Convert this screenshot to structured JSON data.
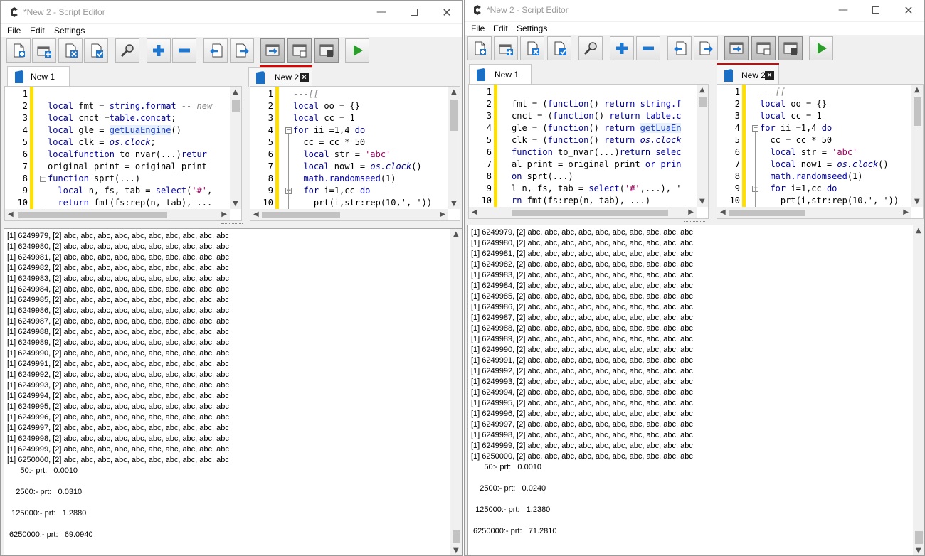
{
  "windows": [
    {
      "id": "winA",
      "title": "*New 2 - Script Editor",
      "menu": [
        "File",
        "Edit",
        "Settings"
      ],
      "tabs": [
        {
          "label": "New 1"
        },
        {
          "label": "New 2"
        }
      ],
      "editor1": {
        "line_numbers": [
          "1",
          "2",
          "3",
          "4",
          "5",
          "6",
          "7",
          "8",
          "9",
          "10"
        ],
        "lines": [
          [],
          [
            [
              "kw",
              "local"
            ],
            [
              "",
              "fmt = "
            ],
            [
              "blt",
              "string.format"
            ],
            [
              "cm",
              " -- new"
            ]
          ],
          [
            [
              "kw",
              "local"
            ],
            [
              "",
              "cnct ="
            ],
            [
              "blt",
              "table.concat"
            ],
            [
              "",
              ";"
            ]
          ],
          [
            [
              "kw",
              "local"
            ],
            [
              "",
              "gle = "
            ],
            [
              "hl",
              "getLuaEngine"
            ],
            [
              "",
              "()"
            ]
          ],
          [
            [
              "kw",
              "local"
            ],
            [
              "",
              "clk = "
            ],
            [
              "it",
              "os.clock"
            ],
            [
              "",
              ";"
            ]
          ],
          [
            [
              "kw",
              "local"
            ],
            [
              "",
              ""
            ],
            [
              "kw",
              "function"
            ],
            [
              "",
              " to_nvar(...)"
            ],
            [
              "kw",
              "retur"
            ]
          ],
          [
            [
              "",
              "original_print = original_print"
            ]
          ],
          [
            [
              "kw",
              "function"
            ],
            [
              "",
              " sprt(...)"
            ]
          ],
          [
            [
              "",
              "  "
            ],
            [
              "kw",
              "local"
            ],
            [
              "",
              " n, fs, tab = "
            ],
            [
              "blt",
              "select"
            ],
            [
              "",
              "("
            ],
            [
              "str",
              "'#'"
            ],
            [
              "",
              ","
            ]
          ],
          [
            [
              "",
              "  "
            ],
            [
              "kw",
              "return"
            ],
            [
              "",
              " fmt(fs:rep(n, tab), ..."
            ]
          ]
        ]
      },
      "editor2": {
        "line_numbers": [
          "1",
          "2",
          "3",
          "4",
          "5",
          "6",
          "7",
          "8",
          "9",
          "10"
        ],
        "lines": [
          [
            [
              "cm",
              "---[["
            ]
          ],
          [
            [
              "kw",
              "local"
            ],
            [
              "",
              " oo = {}"
            ]
          ],
          [
            [
              "kw",
              "local"
            ],
            [
              "",
              " cc = 1"
            ]
          ],
          [
            [
              "kw",
              "for"
            ],
            [
              "",
              " ii =1,4 "
            ],
            [
              "kw",
              "do"
            ]
          ],
          [
            [
              "",
              "  cc = cc * 50"
            ]
          ],
          [
            [
              "",
              "  "
            ],
            [
              "kw",
              "local"
            ],
            [
              "",
              " str = "
            ],
            [
              "str",
              "'abc'"
            ]
          ],
          [
            [
              "",
              "  "
            ],
            [
              "kw",
              "local"
            ],
            [
              "",
              " now1 = "
            ],
            [
              "it",
              "os.clock"
            ],
            [
              "",
              "()"
            ]
          ],
          [
            [
              "",
              "  "
            ],
            [
              "blt",
              "math.randomseed"
            ],
            [
              "",
              "(1)"
            ]
          ],
          [
            [
              "",
              "  "
            ],
            [
              "kw",
              "for"
            ],
            [
              "",
              " i=1,cc "
            ],
            [
              "kw",
              "do"
            ]
          ],
          [
            [
              "",
              "    prt(i,str:rep(10,', '))"
            ]
          ]
        ]
      },
      "output": {
        "lines": [
          "[1] 6249979, [2] abc, abc, abc, abc, abc, abc, abc, abc, abc, abc",
          "[1] 6249980, [2] abc, abc, abc, abc, abc, abc, abc, abc, abc, abc",
          "[1] 6249981, [2] abc, abc, abc, abc, abc, abc, abc, abc, abc, abc",
          "[1] 6249982, [2] abc, abc, abc, abc, abc, abc, abc, abc, abc, abc",
          "[1] 6249983, [2] abc, abc, abc, abc, abc, abc, abc, abc, abc, abc",
          "[1] 6249984, [2] abc, abc, abc, abc, abc, abc, abc, abc, abc, abc",
          "[1] 6249985, [2] abc, abc, abc, abc, abc, abc, abc, abc, abc, abc",
          "[1] 6249986, [2] abc, abc, abc, abc, abc, abc, abc, abc, abc, abc",
          "[1] 6249987, [2] abc, abc, abc, abc, abc, abc, abc, abc, abc, abc",
          "[1] 6249988, [2] abc, abc, abc, abc, abc, abc, abc, abc, abc, abc",
          "[1] 6249989, [2] abc, abc, abc, abc, abc, abc, abc, abc, abc, abc",
          "[1] 6249990, [2] abc, abc, abc, abc, abc, abc, abc, abc, abc, abc",
          "[1] 6249991, [2] abc, abc, abc, abc, abc, abc, abc, abc, abc, abc",
          "[1] 6249992, [2] abc, abc, abc, abc, abc, abc, abc, abc, abc, abc",
          "[1] 6249993, [2] abc, abc, abc, abc, abc, abc, abc, abc, abc, abc",
          "[1] 6249994, [2] abc, abc, abc, abc, abc, abc, abc, abc, abc, abc",
          "[1] 6249995, [2] abc, abc, abc, abc, abc, abc, abc, abc, abc, abc",
          "[1] 6249996, [2] abc, abc, abc, abc, abc, abc, abc, abc, abc, abc",
          "[1] 6249997, [2] abc, abc, abc, abc, abc, abc, abc, abc, abc, abc",
          "[1] 6249998, [2] abc, abc, abc, abc, abc, abc, abc, abc, abc, abc",
          "[1] 6249999, [2] abc, abc, abc, abc, abc, abc, abc, abc, abc, abc",
          "[1] 6250000, [2] abc, abc, abc, abc, abc, abc, abc, abc, abc, abc",
          "      50:- prt:   0.0010",
          "",
          "    2500:- prt:   0.0310",
          "",
          "  125000:- prt:   1.2880",
          "",
          " 6250000:- prt:   69.0940"
        ]
      }
    },
    {
      "id": "winB",
      "title": "*New 2 - Script Editor",
      "menu": [
        "File",
        "Edit",
        "Settings"
      ],
      "tabs": [
        {
          "label": "New 1"
        },
        {
          "label": "New 2"
        }
      ],
      "editor1": {
        "line_numbers": [
          "1",
          "2",
          "3",
          "4",
          "5",
          "6",
          "7",
          "8",
          "9",
          "10"
        ],
        "lines": [
          [],
          [
            [
              "",
              "fmt = ("
            ],
            [
              "kw",
              "function"
            ],
            [
              "",
              "() "
            ],
            [
              "kw",
              "return"
            ],
            [
              "",
              " "
            ],
            [
              "blt",
              "string.f"
            ]
          ],
          [
            [
              "",
              "cnct = ("
            ],
            [
              "kw",
              "function"
            ],
            [
              "",
              "() "
            ],
            [
              "kw",
              "return"
            ],
            [
              "",
              " "
            ],
            [
              "blt",
              "table.c"
            ]
          ],
          [
            [
              "",
              "gle = ("
            ],
            [
              "kw",
              "function"
            ],
            [
              "",
              "() "
            ],
            [
              "kw",
              "return"
            ],
            [
              "",
              " "
            ],
            [
              "hl",
              "getLuaEn"
            ]
          ],
          [
            [
              "",
              "clk = ("
            ],
            [
              "kw",
              "function"
            ],
            [
              "",
              "() "
            ],
            [
              "kw",
              "return"
            ],
            [
              "",
              " "
            ],
            [
              "it",
              "os.clock"
            ]
          ],
          [
            [
              "kw",
              "function"
            ],
            [
              "",
              " to_nvar(...)"
            ],
            [
              "kw",
              "return"
            ],
            [
              "",
              " "
            ],
            [
              "blt",
              "selec"
            ]
          ],
          [
            [
              "",
              "al_print = original_print "
            ],
            [
              "kw",
              "or"
            ],
            [
              "",
              " "
            ],
            [
              "blt",
              "prin"
            ]
          ],
          [
            [
              "kw",
              "on"
            ],
            [
              "",
              " sprt(...)"
            ]
          ],
          [
            [
              "",
              "l n, fs, tab = "
            ],
            [
              "blt",
              "select"
            ],
            [
              "",
              "("
            ],
            [
              "str",
              "'#'"
            ],
            [
              "",
              ",...), '"
            ]
          ],
          [
            [
              "kw",
              "rn"
            ],
            [
              "",
              " fmt(fs:rep(n, tab), ...)"
            ]
          ]
        ]
      },
      "editor2": {
        "line_numbers": [
          "1",
          "2",
          "3",
          "4",
          "5",
          "6",
          "7",
          "8",
          "9",
          "10"
        ],
        "lines": [
          [
            [
              "cm",
              "---[["
            ]
          ],
          [
            [
              "kw",
              "local"
            ],
            [
              "",
              " oo = {}"
            ]
          ],
          [
            [
              "kw",
              "local"
            ],
            [
              "",
              " cc = 1"
            ]
          ],
          [
            [
              "kw",
              "for"
            ],
            [
              "",
              " ii =1,4 "
            ],
            [
              "kw",
              "do"
            ]
          ],
          [
            [
              "",
              "  cc = cc * 50"
            ]
          ],
          [
            [
              "",
              "  "
            ],
            [
              "kw",
              "local"
            ],
            [
              "",
              " str = "
            ],
            [
              "str",
              "'abc'"
            ]
          ],
          [
            [
              "",
              "  "
            ],
            [
              "kw",
              "local"
            ],
            [
              "",
              " now1 = "
            ],
            [
              "it",
              "os.clock"
            ],
            [
              "",
              "()"
            ]
          ],
          [
            [
              "",
              "  "
            ],
            [
              "blt",
              "math.randomseed"
            ],
            [
              "",
              "(1)"
            ]
          ],
          [
            [
              "",
              "  "
            ],
            [
              "kw",
              "for"
            ],
            [
              "",
              " i=1,cc "
            ],
            [
              "kw",
              "do"
            ]
          ],
          [
            [
              "",
              "    prt(i,str:rep(10,', '))"
            ]
          ]
        ]
      },
      "output": {
        "lines": [
          "[1] 6249979, [2] abc, abc, abc, abc, abc, abc, abc, abc, abc, abc",
          "[1] 6249980, [2] abc, abc, abc, abc, abc, abc, abc, abc, abc, abc",
          "[1] 6249981, [2] abc, abc, abc, abc, abc, abc, abc, abc, abc, abc",
          "[1] 6249982, [2] abc, abc, abc, abc, abc, abc, abc, abc, abc, abc",
          "[1] 6249983, [2] abc, abc, abc, abc, abc, abc, abc, abc, abc, abc",
          "[1] 6249984, [2] abc, abc, abc, abc, abc, abc, abc, abc, abc, abc",
          "[1] 6249985, [2] abc, abc, abc, abc, abc, abc, abc, abc, abc, abc",
          "[1] 6249986, [2] abc, abc, abc, abc, abc, abc, abc, abc, abc, abc",
          "[1] 6249987, [2] abc, abc, abc, abc, abc, abc, abc, abc, abc, abc",
          "[1] 6249988, [2] abc, abc, abc, abc, abc, abc, abc, abc, abc, abc",
          "[1] 6249989, [2] abc, abc, abc, abc, abc, abc, abc, abc, abc, abc",
          "[1] 6249990, [2] abc, abc, abc, abc, abc, abc, abc, abc, abc, abc",
          "[1] 6249991, [2] abc, abc, abc, abc, abc, abc, abc, abc, abc, abc",
          "[1] 6249992, [2] abc, abc, abc, abc, abc, abc, abc, abc, abc, abc",
          "[1] 6249993, [2] abc, abc, abc, abc, abc, abc, abc, abc, abc, abc",
          "[1] 6249994, [2] abc, abc, abc, abc, abc, abc, abc, abc, abc, abc",
          "[1] 6249995, [2] abc, abc, abc, abc, abc, abc, abc, abc, abc, abc",
          "[1] 6249996, [2] abc, abc, abc, abc, abc, abc, abc, abc, abc, abc",
          "[1] 6249997, [2] abc, abc, abc, abc, abc, abc, abc, abc, abc, abc",
          "[1] 6249998, [2] abc, abc, abc, abc, abc, abc, abc, abc, abc, abc",
          "[1] 6249999, [2] abc, abc, abc, abc, abc, abc, abc, abc, abc, abc",
          "[1] 6250000, [2] abc, abc, abc, abc, abc, abc, abc, abc, abc, abc",
          "      50:- prt:   0.0010",
          "",
          "    2500:- prt:   0.0240",
          "",
          "  125000:- prt:   1.2380",
          "",
          " 6250000:- prt:   71.2810"
        ]
      }
    }
  ],
  "colors": {
    "keyword": "#00009f",
    "string": "#a0005f",
    "comment": "#888888",
    "gutter_marker": "#ffe000",
    "active_tab_marker": "#e00000",
    "run_icon": "#2a9d2a"
  },
  "toolbar_icons": [
    "new-file-icon",
    "new-tab-icon",
    "close-file-icon",
    "save-file-icon",
    "search-icon",
    "zoom-in-icon",
    "zoom-out-icon",
    "undo-icon",
    "redo-icon",
    "layout-1-icon",
    "layout-2-icon",
    "layout-3-icon",
    "run-icon"
  ]
}
